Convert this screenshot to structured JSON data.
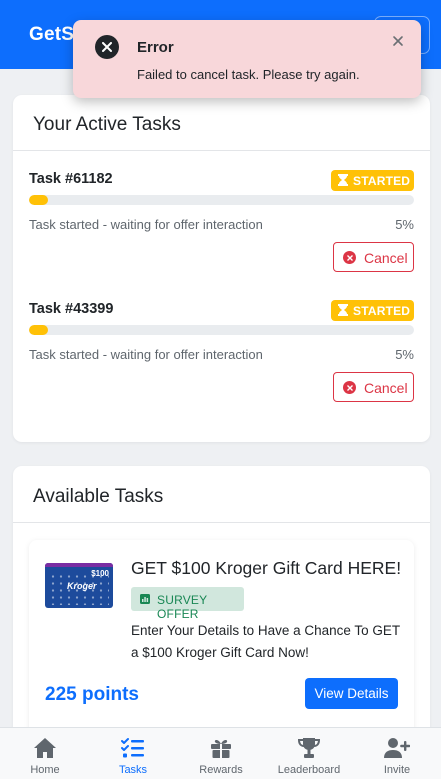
{
  "app": {
    "brand": "GetS"
  },
  "toast": {
    "title": "Error",
    "message": "Failed to cancel task. Please try again."
  },
  "active_tasks": {
    "title": "Your Active Tasks",
    "tasks": [
      {
        "id": "Task #61182",
        "badge": "STARTED",
        "status": "Task started - waiting for offer interaction",
        "percent_label": "5%",
        "progress": 0.05,
        "cancel_label": "Cancel"
      },
      {
        "id": "Task #43399",
        "badge": "STARTED",
        "status": "Task started - waiting for offer interaction",
        "percent_label": "5%",
        "progress": 0.05,
        "cancel_label": "Cancel"
      }
    ]
  },
  "available_tasks": {
    "title": "Available Tasks",
    "offers": [
      {
        "title": "GET $100 Kroger Gift Card HERE!",
        "tag": "SURVEY OFFER",
        "description": "Enter Your Details to Have a Chance To GET a $100 Kroger Gift Card Now!",
        "points": "225 points",
        "button": "View Details",
        "image_text": {
          "amount": "$100",
          "brand": "Kroger"
        }
      }
    ]
  },
  "bottom_nav": {
    "items": [
      {
        "label": "Home",
        "icon": "home-icon"
      },
      {
        "label": "Tasks",
        "icon": "tasks-icon"
      },
      {
        "label": "Rewards",
        "icon": "gift-icon"
      },
      {
        "label": "Leaderboard",
        "icon": "trophy-icon"
      },
      {
        "label": "Invite",
        "icon": "user-plus-icon"
      }
    ],
    "active": "Tasks"
  },
  "colors": {
    "primary": "#0d6efd",
    "danger": "#dc3545",
    "warning": "#ffc107",
    "success": "#198754",
    "toast_bg": "#f8d7da"
  }
}
